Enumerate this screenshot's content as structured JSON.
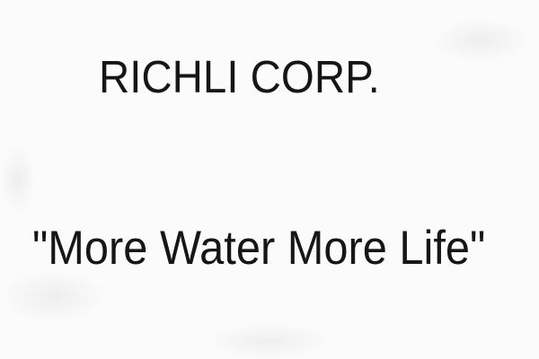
{
  "document": {
    "company_name": "RICHLI CORP.",
    "slogan": "\"More Water More Life\""
  }
}
